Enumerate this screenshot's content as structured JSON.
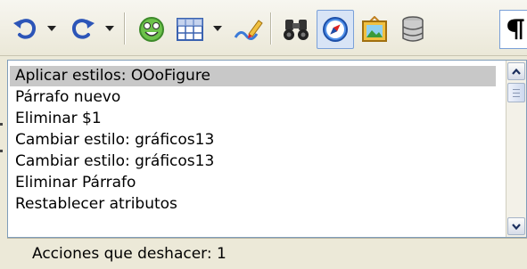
{
  "toolbar": {
    "buttons": [
      {
        "icon": "undo-icon"
      },
      {
        "icon": "redo-icon"
      },
      {
        "icon": "smiley-icon"
      },
      {
        "icon": "table-icon"
      },
      {
        "icon": "draw-pencil-icon"
      },
      {
        "icon": "binoculars-icon"
      },
      {
        "icon": "navigator-compass-icon"
      },
      {
        "icon": "gallery-picture-icon"
      },
      {
        "icon": "database-icon"
      },
      {
        "icon": "pilcrow-icon"
      }
    ]
  },
  "undo_list": {
    "items": [
      {
        "label": "Aplicar estilos: OOoFigure",
        "selected": true
      },
      {
        "label": "Párrafo nuevo"
      },
      {
        "label": "Eliminar $1"
      },
      {
        "label": "Cambiar estilo: gráficos13"
      },
      {
        "label": "Cambiar estilo: gráficos13"
      },
      {
        "label": "Eliminar Párrafo"
      },
      {
        "label": "Restablecer atributos"
      }
    ]
  },
  "status": {
    "text": "Acciones que deshacer: 1"
  }
}
